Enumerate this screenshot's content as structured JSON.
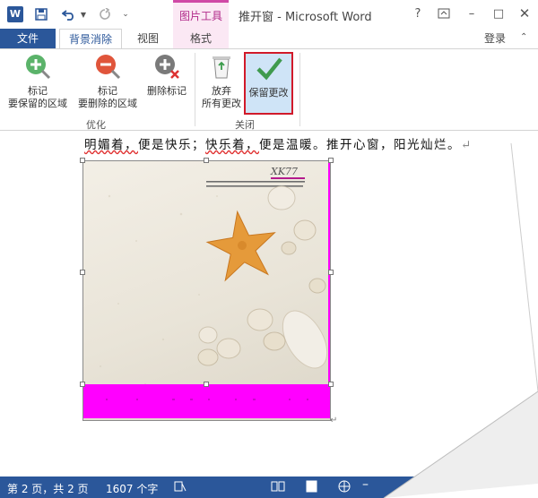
{
  "titlebar": {
    "app_icon": "W",
    "context_tab_header": "图片工具",
    "document_title": "推开窗 - Microsoft Word",
    "help": "?",
    "restore_icon": "ribbon-display-icon",
    "minimize": "–",
    "maximize": "□"
  },
  "tabs": {
    "file": "文件",
    "background_removal": "背景消除",
    "view": "视图",
    "format": "格式",
    "login": "登录"
  },
  "ribbon": {
    "mark_keep_line1": "标记",
    "mark_keep_line2": "要保留的区域",
    "mark_remove_line1": "标记",
    "mark_remove_line2": "要删除的区域",
    "delete_mark": "删除标记",
    "group_optimize": "优化",
    "discard_line1": "放弃",
    "discard_line2": "所有更改",
    "keep_changes": "保留更改",
    "group_close": "关闭"
  },
  "document": {
    "text_part1": "明媚着，",
    "text_part2": "便是快乐；",
    "text_part3": "快乐着，",
    "text_part4": "便是温暖。推开心窗，阳光灿烂。",
    "paragraph_mark": "↵",
    "image_caption": "XK77"
  },
  "status": {
    "page": "第 2 页，共 2 页",
    "words": "1607 个字"
  },
  "colors": {
    "word_blue": "#2b579a",
    "context_pink": "#b12a8a",
    "removal_magenta": "#ff00ff",
    "keep_highlight": "#d11a2a"
  }
}
